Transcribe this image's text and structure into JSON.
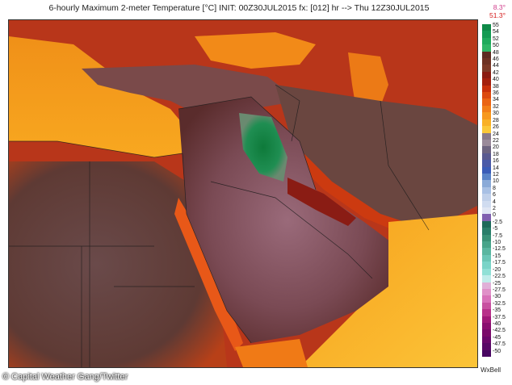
{
  "header": {
    "title": "6-hourly Maximum 2-meter Temperature [°C] INIT: 00Z30JUL2015 fx: [012] hr --> Thu 12Z30JUL2015",
    "min_value": "8.3°",
    "max_value": "51.3°"
  },
  "legend": {
    "labels": [
      "55",
      "54",
      "52",
      "50",
      "48",
      "46",
      "44",
      "42",
      "40",
      "38",
      "36",
      "34",
      "32",
      "30",
      "28",
      "26",
      "24",
      "22",
      "20",
      "18",
      "16",
      "14",
      "12",
      "10",
      "8",
      "6",
      "4",
      "2",
      "0",
      "-2.5",
      "-5",
      "-7.5",
      "-10",
      "-12.5",
      "-15",
      "-17.5",
      "-20",
      "-22.5",
      "-25",
      "-27.5",
      "-30",
      "-32.5",
      "-35",
      "-37.5",
      "-40",
      "-42.5",
      "-45",
      "-47.5",
      "-50"
    ],
    "colors": [
      "#0e8a48",
      "#149a52",
      "#1faa5c",
      "#2fb666",
      "#5e2c22",
      "#6e3224",
      "#7d3a28",
      "#8b1c12",
      "#a4200e",
      "#c8300c",
      "#dc4a10",
      "#ea6414",
      "#f27e18",
      "#f7981e",
      "#f9b126",
      "#fbc838",
      "#8a7a8a",
      "#9a8a9a",
      "#6e6480",
      "#5a5a90",
      "#4a5aa8",
      "#3a5cb8",
      "#5a84c8",
      "#8aaad8",
      "#a8c0e4",
      "#c0d0ea",
      "#d0dcf0",
      "#e0e6f4",
      "#8060b0",
      "#1e6a5a",
      "#2a7e6a",
      "#3a9278",
      "#48a48a",
      "#5ab6a0",
      "#6ac6b6",
      "#7ad4c8",
      "#90e0d6",
      "#c0ecea",
      "#e0b0d8",
      "#e090c8",
      "#d870b8",
      "#c850a0",
      "#b8308a",
      "#a01878",
      "#8a0e70",
      "#7a0a6a",
      "#6a086a",
      "#580866",
      "#480662"
    ]
  },
  "credit": {
    "text": "© Capital Weather Gang/Twitter"
  },
  "brand": {
    "text": "WxBell"
  }
}
